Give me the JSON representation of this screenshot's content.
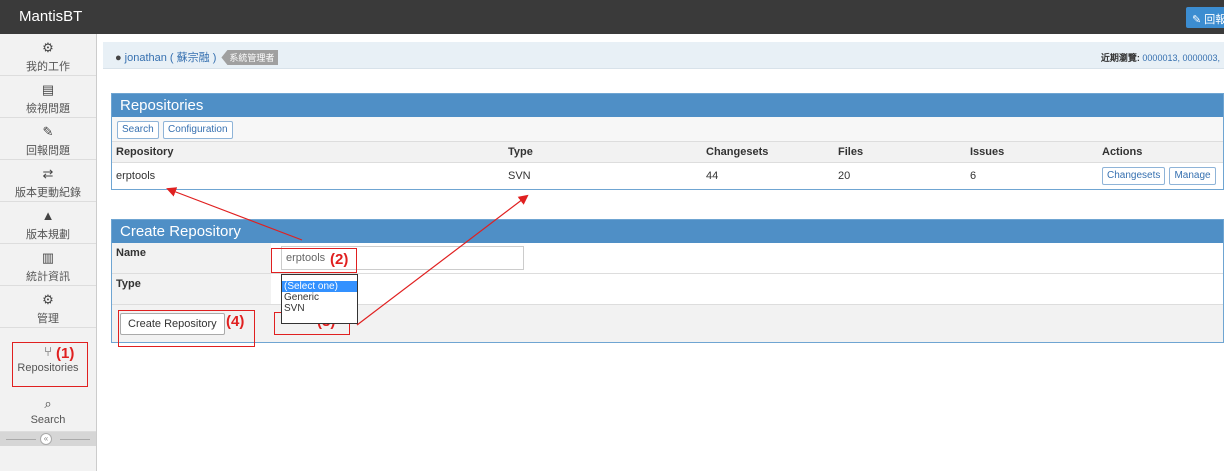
{
  "header": {
    "brand": "MantisBT",
    "report_button": "回報"
  },
  "sidebar": {
    "items": [
      {
        "label": "我的工作",
        "icon": "tachometer-icon"
      },
      {
        "label": "檢視問題",
        "icon": "list-icon"
      },
      {
        "label": "回報問題",
        "icon": "edit-icon"
      },
      {
        "label": "版本更動紀錄",
        "icon": "retweet-icon"
      },
      {
        "label": "版本規劃",
        "icon": "road-icon"
      },
      {
        "label": "統計資訊",
        "icon": "bar-chart-icon"
      },
      {
        "label": "管理",
        "icon": "gears-icon"
      },
      {
        "label": "Repositories",
        "icon": "code-fork-icon"
      },
      {
        "label": "Search",
        "icon": "search-icon"
      }
    ],
    "collapse_icon": "double-angle-left-icon"
  },
  "userbar": {
    "user": "jonathan ( 蘇宗融 )",
    "role": "系統管理者",
    "recent_label": "近期瀏覽:",
    "recent_links": "0000013, 0000003,"
  },
  "repositories": {
    "title": "Repositories",
    "buttons": [
      "Search",
      "Configuration"
    ],
    "columns": [
      "Repository",
      "Type",
      "Changesets",
      "Files",
      "Issues",
      "Actions"
    ],
    "rows": [
      {
        "repository": "erptools",
        "type": "SVN",
        "changesets": "44",
        "files": "20",
        "issues": "6",
        "actions": [
          "Changesets",
          "Manage"
        ]
      }
    ]
  },
  "create": {
    "title": "Create Repository",
    "name_label": "Name",
    "name_value": "erptools",
    "type_label": "Type",
    "type_options": [
      "(Select one)",
      "Generic",
      "SVN"
    ],
    "selected_option": "(Select one)",
    "submit": "Create Repository"
  },
  "annotations": [
    "(1)",
    "(2)",
    "(3)",
    "(4)"
  ],
  "colors": {
    "topbar": "#3a3a3a",
    "widget_header": "#4f8fc6",
    "annotation": "#e02020",
    "link": "#3670b0"
  }
}
